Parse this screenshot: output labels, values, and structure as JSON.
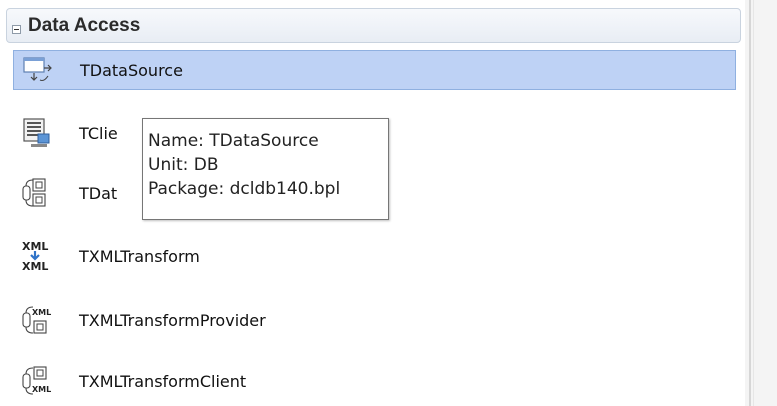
{
  "category": {
    "title": "Data Access",
    "toggle_symbol": "minus"
  },
  "items": [
    {
      "label": "TDataSource",
      "icon": "datasource-icon",
      "selected": true
    },
    {
      "label": "TClie",
      "icon": "client-dataset-icon",
      "selected": false
    },
    {
      "label": "TDat",
      "icon": "dataset-provider-icon",
      "selected": false
    },
    {
      "label": "TXMLTransform",
      "icon": "xml-transform-icon",
      "selected": false
    },
    {
      "label": "TXMLTransformProvider",
      "icon": "xml-transform-provider-icon",
      "selected": false
    },
    {
      "label": "TXMLTransformClient",
      "icon": "xml-transform-client-icon",
      "selected": false
    }
  ],
  "tooltip": {
    "name_line": "Name: TDataSource",
    "unit_line": "Unit: DB",
    "package_line": "Package: dcldb140.bpl"
  },
  "colors": {
    "selection": "#bed2f5",
    "selection_border": "#8fb0e0",
    "header_border": "#c9d3df",
    "xml_arrow": "#2f73c8"
  },
  "icon_text": {
    "xml": "XML"
  }
}
